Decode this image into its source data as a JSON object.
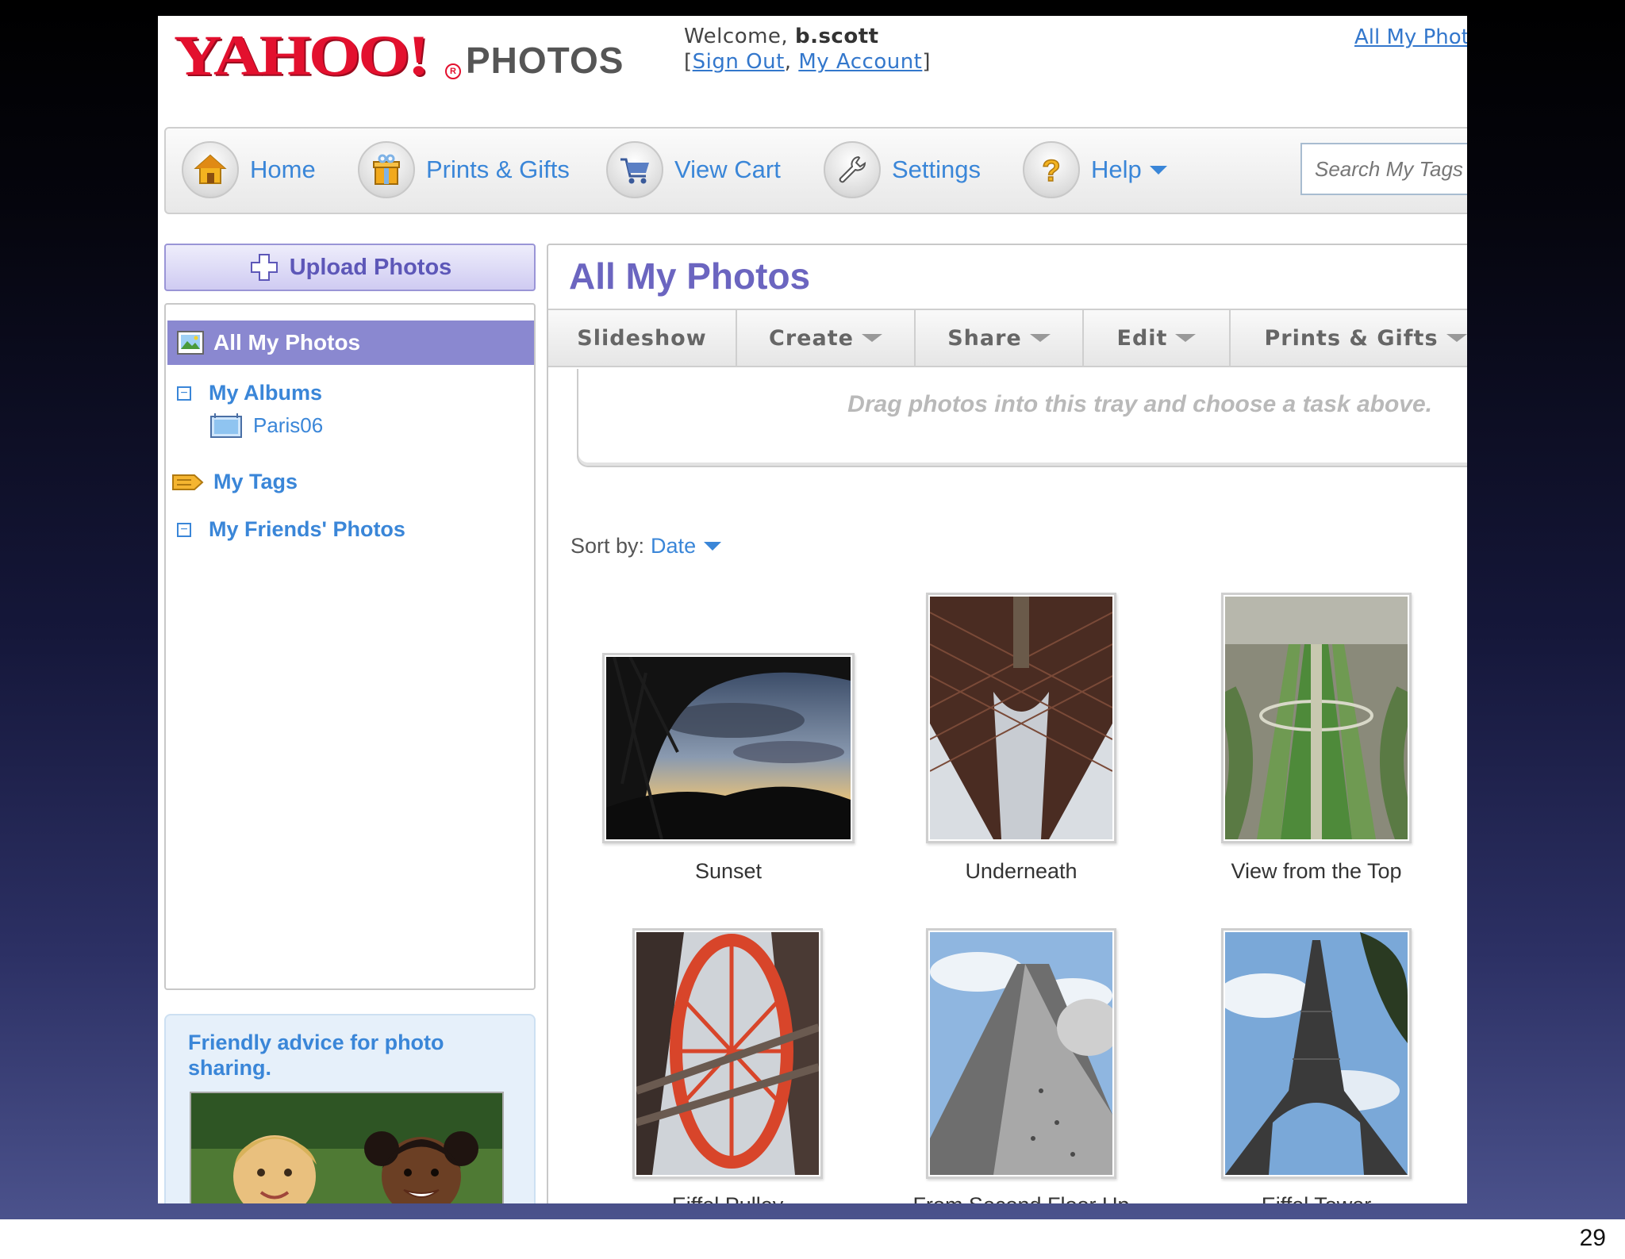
{
  "slide": {
    "number": "29"
  },
  "header": {
    "logo_yahoo": "YAHOO!",
    "logo_photos": "PHOTOS",
    "welcome_prefix": "Welcome,",
    "username": "b.scott",
    "sign_out": "Sign Out",
    "my_account": "My Account",
    "top_right_link": "All My Phot"
  },
  "toolbar": {
    "items": [
      {
        "label": "Home",
        "icon": "house-icon"
      },
      {
        "label": "Prints & Gifts",
        "icon": "gift-icon"
      },
      {
        "label": "View Cart",
        "icon": "cart-icon"
      },
      {
        "label": "Settings",
        "icon": "wrench-icon"
      },
      {
        "label": "Help",
        "icon": "question-icon"
      }
    ],
    "search_placeholder": "Search My Tags"
  },
  "sidebar": {
    "upload_label": "Upload Photos",
    "all_photos": "All My Photos",
    "my_albums": "My Albums",
    "album_paris": "Paris06",
    "my_tags": "My Tags",
    "friends_photos": "My Friends' Photos",
    "advice": "Friendly advice for photo sharing."
  },
  "main": {
    "title": "All My Photos",
    "actions": [
      "Slideshow",
      "Create",
      "Share",
      "Edit",
      "Prints & Gifts"
    ],
    "tray_hint": "Drag photos into this tray and choose a task above.",
    "sort_label": "Sort by:",
    "sort_value": "Date",
    "photos": [
      {
        "caption": "Sunset"
      },
      {
        "caption": "Underneath"
      },
      {
        "caption": "View from the Top"
      },
      {
        "caption": "Eiffel Pulley"
      },
      {
        "caption": "From Second Floor Up"
      },
      {
        "caption": "Eiffel Tower"
      }
    ]
  },
  "colors": {
    "yahoo_red": "#e3102e",
    "link_blue": "#3a86d8",
    "nav_selected": "#8a88d0",
    "title_purple": "#6b65c0"
  }
}
